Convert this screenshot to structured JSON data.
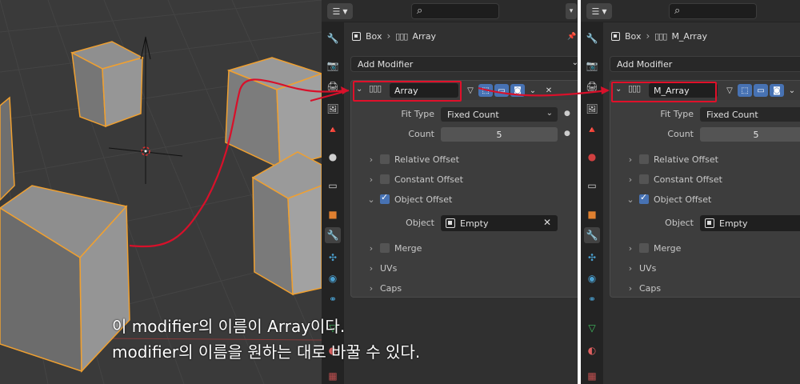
{
  "caption": {
    "line1": "이 modifier의 이름이 Array이다.",
    "line2": "modifier의 이름을 원하는 대로 바꿀 수 있다."
  },
  "colors": {
    "highlight": "#e0102a",
    "accent_blue": "#4772b3",
    "selection_orange": "#f0a030"
  },
  "left_panel": {
    "breadcrumb": {
      "object": "Box",
      "modifier": "Array"
    },
    "add_modifier": "Add Modifier",
    "modifier_name": "Array",
    "fit_type_label": "Fit Type",
    "fit_type_value": "Fixed Count",
    "count_label": "Count",
    "count_value": "5",
    "relative_offset": "Relative Offset",
    "constant_offset": "Constant Offset",
    "object_offset": "Object Offset",
    "object_label": "Object",
    "object_value": "Empty",
    "merge": "Merge",
    "uvs": "UVs",
    "caps": "Caps"
  },
  "right_panel": {
    "breadcrumb": {
      "object": "Box",
      "modifier": "M_Array"
    },
    "add_modifier": "Add Modifier",
    "modifier_name": "M_Array",
    "fit_type_label": "Fit Type",
    "fit_type_value": "Fixed Count",
    "count_label": "Count",
    "count_value": "5",
    "relative_offset": "Relative Offset",
    "constant_offset": "Constant Offset",
    "object_offset": "Object Offset",
    "object_label": "Object",
    "object_value": "Empty",
    "merge": "Merge",
    "uvs": "UVs",
    "caps": "Caps"
  },
  "icons": {
    "tabs": [
      "tool-icon",
      "render-icon",
      "output-icon",
      "view-layer-icon",
      "scene-icon",
      "world-icon",
      "collection-icon",
      "object-icon",
      "modifier-wrench-icon",
      "particles-icon",
      "physics-icon",
      "constraints-icon",
      "data-icon",
      "material-icon",
      "texture-icon"
    ]
  }
}
